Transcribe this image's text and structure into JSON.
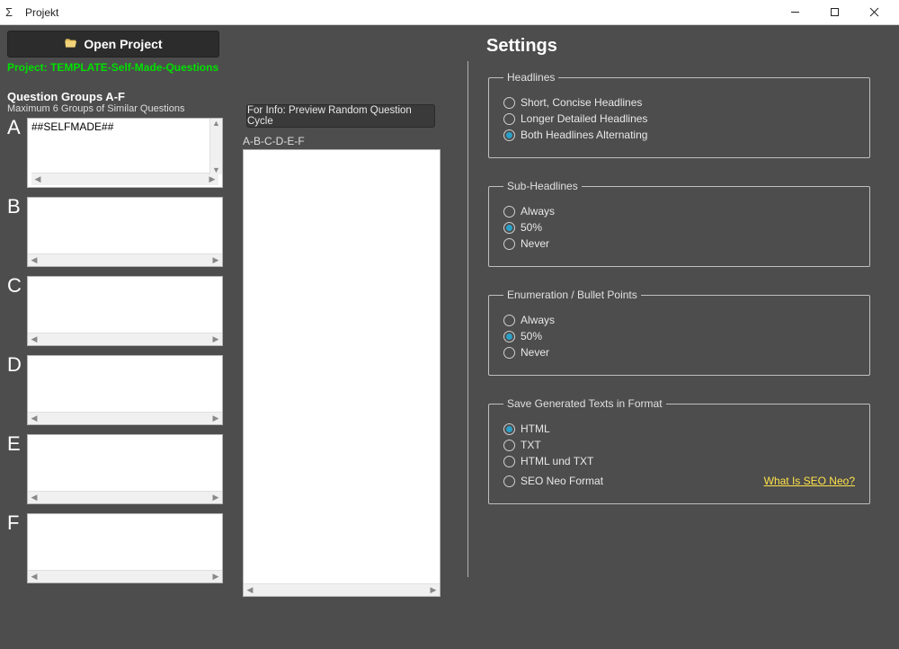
{
  "window": {
    "title": "Projekt"
  },
  "left": {
    "open_project_label": "Open Project",
    "project_path": "Project: TEMPLATE-Self-Made-Questions",
    "groups_title": "Question Groups A-F",
    "groups_subtitle": "Maximum 6 Groups of Similar Questions",
    "groups": [
      {
        "letter": "A",
        "text": "##SELFMADE##"
      },
      {
        "letter": "B",
        "text": ""
      },
      {
        "letter": "C",
        "text": ""
      },
      {
        "letter": "D",
        "text": ""
      },
      {
        "letter": "E",
        "text": ""
      },
      {
        "letter": "F",
        "text": ""
      }
    ],
    "preview_button": "For Info: Preview Random Question Cycle",
    "preview_label": "A-B-C-D-E-F"
  },
  "settings": {
    "title": "Settings",
    "headlines": {
      "legend": "Headlines",
      "options": [
        {
          "label": "Short, Concise Headlines",
          "checked": false
        },
        {
          "label": "Longer Detailed Headlines",
          "checked": false
        },
        {
          "label": "Both Headlines Alternating",
          "checked": true
        }
      ]
    },
    "subheadlines": {
      "legend": "Sub-Headlines",
      "options": [
        {
          "label": "Always",
          "checked": false
        },
        {
          "label": "50%",
          "checked": true
        },
        {
          "label": "Never",
          "checked": false
        }
      ]
    },
    "enumeration": {
      "legend": "Enumeration / Bullet Points",
      "options": [
        {
          "label": "Always",
          "checked": false
        },
        {
          "label": "50%",
          "checked": true
        },
        {
          "label": "Never",
          "checked": false
        }
      ]
    },
    "save_format": {
      "legend": "Save Generated Texts in Format",
      "options": [
        {
          "label": "HTML",
          "checked": true
        },
        {
          "label": "TXT",
          "checked": false
        },
        {
          "label": "HTML und TXT",
          "checked": false
        },
        {
          "label": "SEO Neo Format",
          "checked": false
        }
      ],
      "seo_link": "What Is SEO Neo?"
    }
  }
}
